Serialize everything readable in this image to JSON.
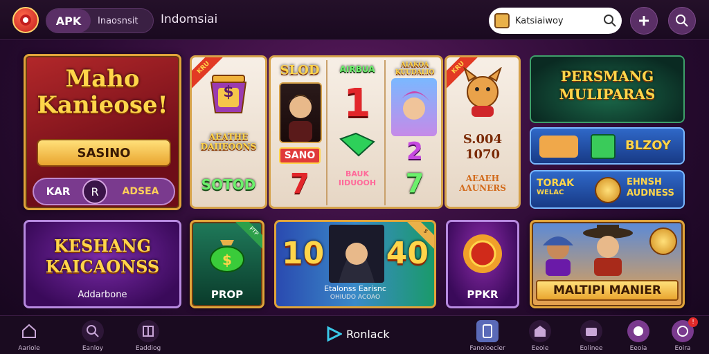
{
  "header": {
    "apk_label": "APK",
    "language": "Inaosnsit",
    "region": "Indomsiai",
    "search_value": "Katsiaiwoy"
  },
  "promo": {
    "title_line1": "Maho",
    "title_line2": "Kanieose!",
    "cta": "SASINO",
    "row_left": "KAR",
    "row_mid": "R",
    "row_right": "ADSEA"
  },
  "slots": {
    "strip1": {
      "ribbon": "KRU",
      "bonus": "AEATHE DAIIEOONS",
      "label": "SOTOD",
      "symbol": "$"
    },
    "strip2": {
      "top": "SLOD",
      "badge": "SANO",
      "num7": "7"
    },
    "strip3": {
      "top": "AIRBUA",
      "num1": "1",
      "bonus": "BAUK IIDUOOH"
    },
    "strip4": {
      "top": "AIAKOA KUUDALIO",
      "num": "2",
      "sym": "7"
    },
    "strip5": {
      "ribbon": "KRU",
      "amount1": "S.004",
      "amount2": "1070",
      "text": "AEAEH AAUNERS"
    }
  },
  "right_panels": {
    "green_title_1": "PERSMANG",
    "green_title_2": "MULIPARAS",
    "blue1_text": "BLZOY",
    "blue2_left_1": "TORAK",
    "blue2_left_2": "WELAC",
    "blue2_right_1": "EHNSH",
    "blue2_right_2": "AUDNESS"
  },
  "bottom": {
    "kc_title_1": "KESHANG",
    "kc_title_2": "KAICAONSS",
    "kc_sub": "Addarbone",
    "prop_label": "PROP",
    "prop_ribbon": "PTP",
    "feature_left": "10",
    "feature_right": "40",
    "feature_text_1": "Etalonss Earisnc",
    "feature_text_2": "OHIUDO ACOAO",
    "feature_ribbon": "$",
    "pokr_label": "PPKR",
    "multi_label": "MALTIPI MANIER"
  },
  "center_brand": "Ronlack",
  "nav": [
    {
      "label": "Aariole",
      "icon": "home-icon"
    },
    {
      "label": "Eanloy",
      "icon": "search-icon"
    },
    {
      "label": "Eaddiog",
      "icon": "grid-icon"
    },
    {
      "label": "Fanoloecier",
      "icon": "phone-icon"
    },
    {
      "label": "Eeoie",
      "icon": "store-icon"
    },
    {
      "label": "Eolinee",
      "icon": "wallet-icon"
    },
    {
      "label": "Eeoia",
      "icon": "chat-icon"
    },
    {
      "label": "Eoira",
      "icon": "profile-icon",
      "badge": "!"
    }
  ],
  "colors": {
    "accent_gold": "#e0a43a",
    "bg": "#2a0b33",
    "brand_red": "#c21d1d"
  }
}
